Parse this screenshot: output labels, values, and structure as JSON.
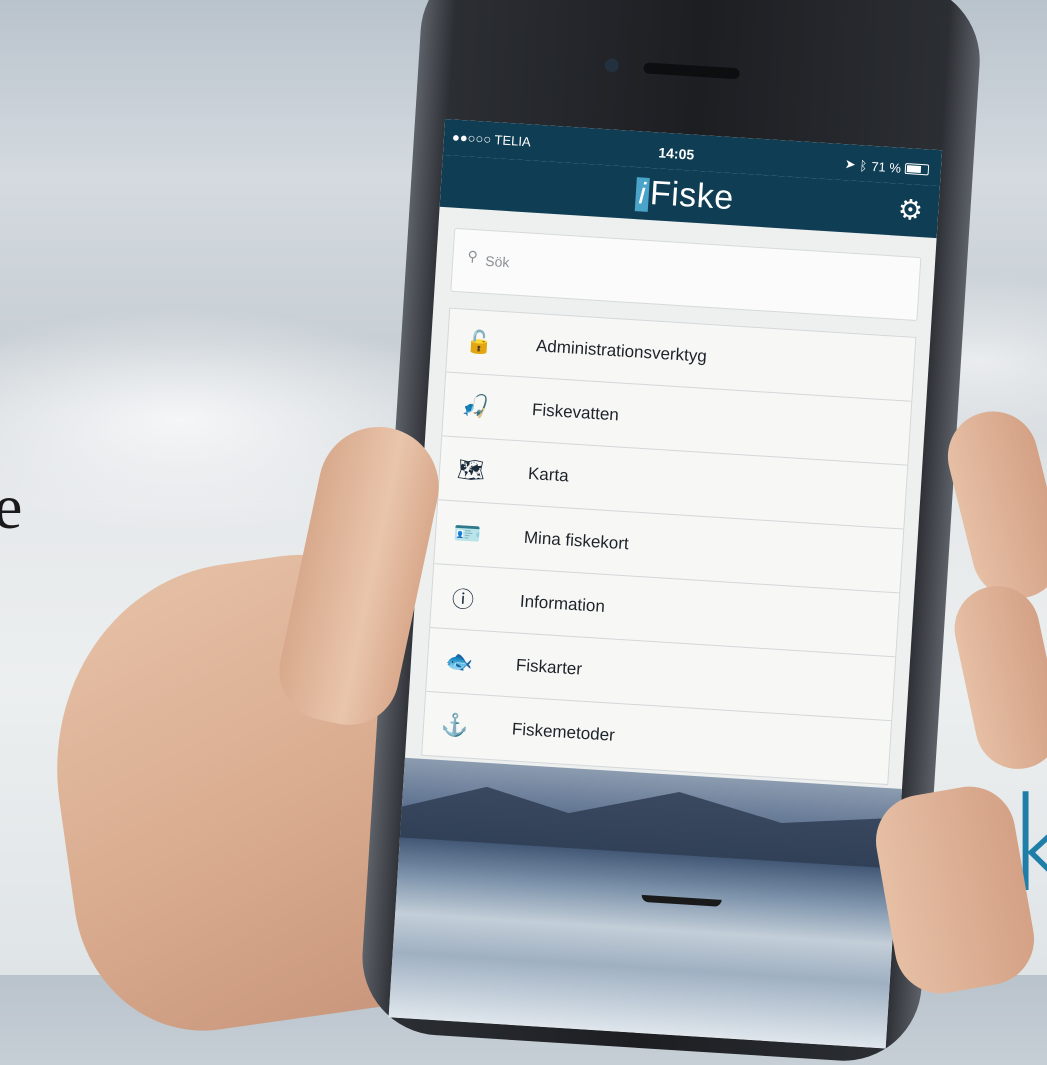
{
  "background": {
    "partial_letter": "e",
    "brand_letter": "k"
  },
  "status_bar": {
    "carrier": "●●○○○ TELIA",
    "time": "14:05",
    "battery": "71 %"
  },
  "app": {
    "title_prefix": "i",
    "title_rest": "Fiske",
    "settings_icon": "gear-icon"
  },
  "search": {
    "placeholder": "Sök"
  },
  "menu": {
    "items": [
      {
        "label": "Administrationsverktyg",
        "icon": "unlock-icon",
        "glyph": "🔓"
      },
      {
        "label": "Fiskevatten",
        "icon": "fishing-water-icon",
        "glyph": "🎣"
      },
      {
        "label": "Karta",
        "icon": "map-icon",
        "glyph": "🗺"
      },
      {
        "label": "Mina fiskekort",
        "icon": "card-icon",
        "glyph": "🪪"
      },
      {
        "label": "Information",
        "icon": "info-icon",
        "glyph": "ⓘ"
      },
      {
        "label": "Fiskarter",
        "icon": "fish-icon",
        "glyph": "🐟"
      },
      {
        "label": "Fiskemetoder",
        "icon": "hook-icon",
        "glyph": "⚓"
      }
    ]
  },
  "colors": {
    "header": "#0e3d54",
    "accent": "#4aa3c9",
    "brand": "#1f7ea8"
  }
}
